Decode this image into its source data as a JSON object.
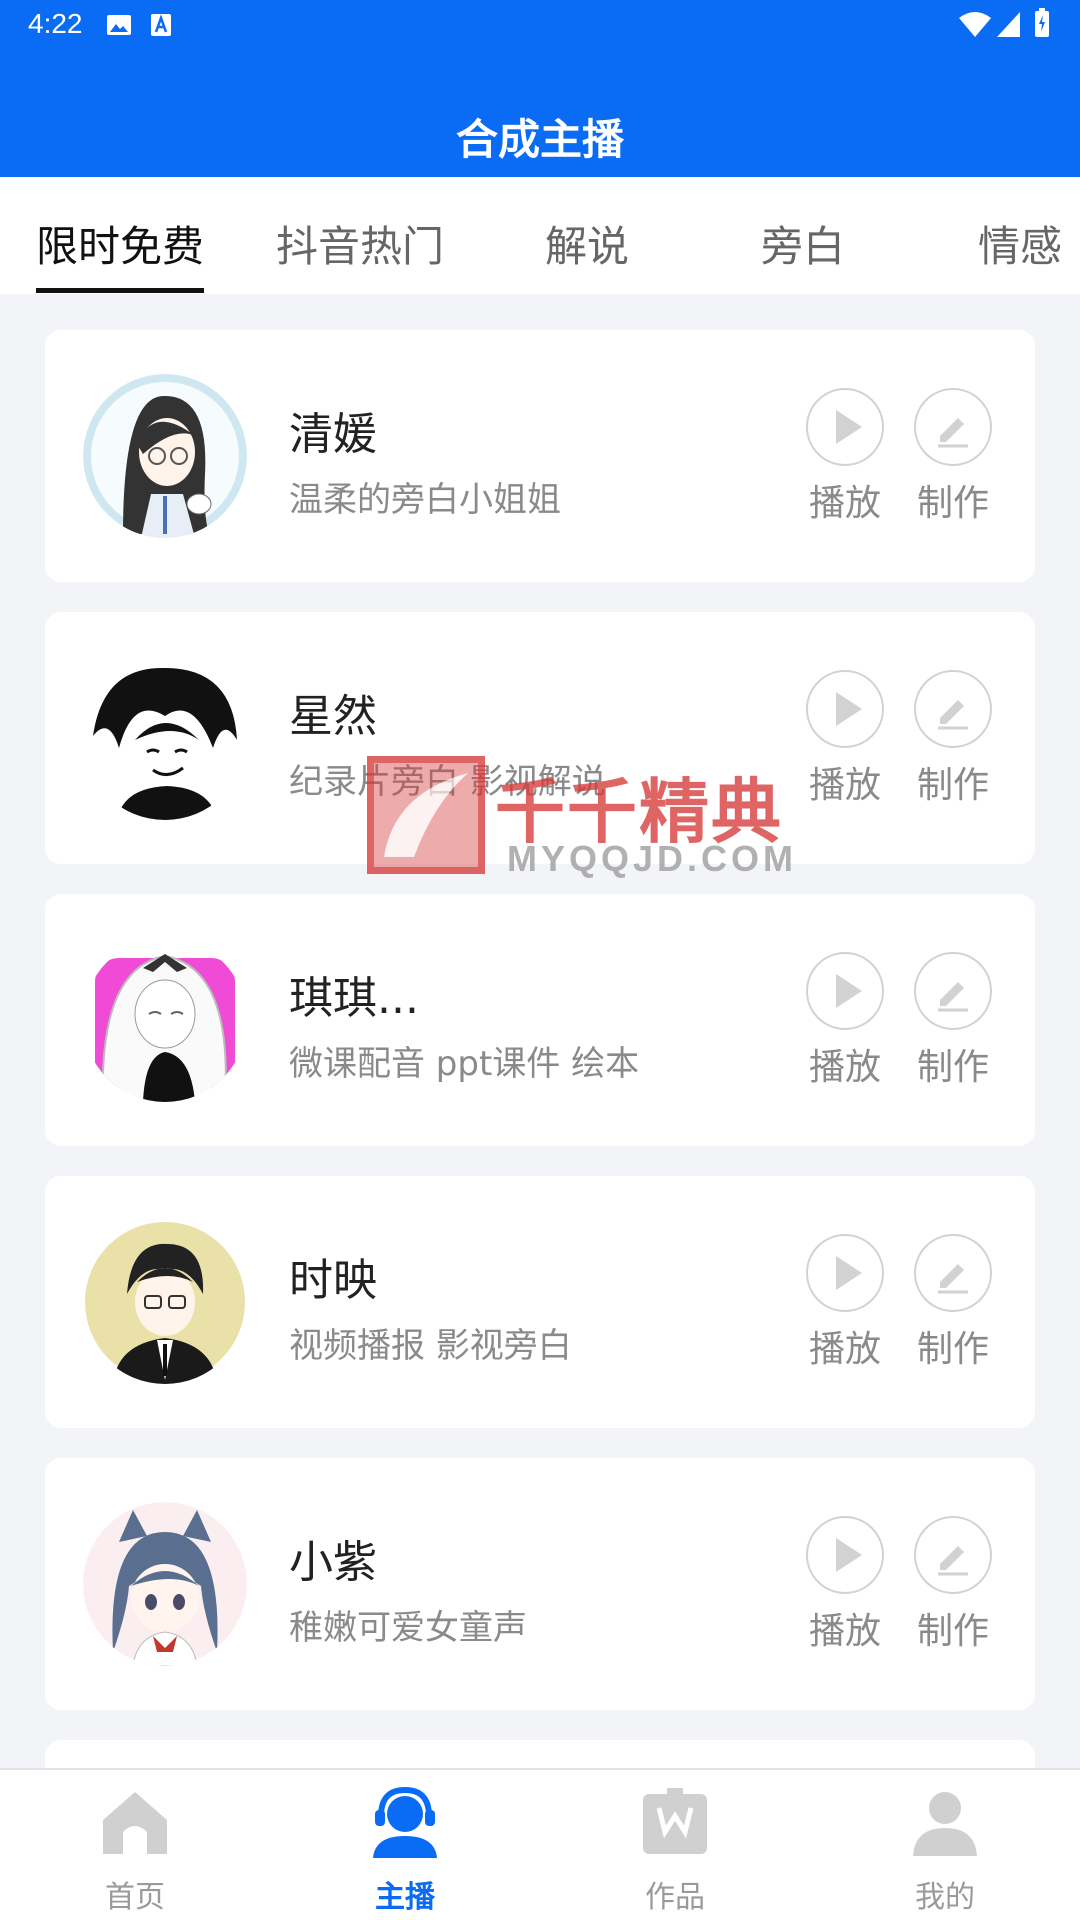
{
  "status_bar": {
    "time": "4:22"
  },
  "header": {
    "title": "合成主播"
  },
  "tabs": [
    {
      "label": "限时免费",
      "active": true
    },
    {
      "label": "抖音热门",
      "active": false
    },
    {
      "label": "解说",
      "active": false
    },
    {
      "label": "旁白",
      "active": false
    },
    {
      "label": "情感",
      "active": false
    }
  ],
  "anchors": [
    {
      "name": "清媛",
      "desc": "温柔的旁白小姐姐",
      "play_label": "播放",
      "make_label": "制作"
    },
    {
      "name": "星然",
      "desc": "纪录片旁白 影视解说",
      "play_label": "播放",
      "make_label": "制作"
    },
    {
      "name": "琪琪...",
      "desc": "微课配音 ppt课件 绘本",
      "play_label": "播放",
      "make_label": "制作"
    },
    {
      "name": "时映",
      "desc": "视频播报  影视旁白",
      "play_label": "播放",
      "make_label": "制作"
    },
    {
      "name": "小紫",
      "desc": "稚嫩可爱女童声",
      "play_label": "播放",
      "make_label": "制作"
    }
  ],
  "watermark": {
    "text_cn": "千千精典",
    "text_en": "MYQQJD.COM"
  },
  "bottom_nav": [
    {
      "label": "首页",
      "icon": "home-icon",
      "active": false
    },
    {
      "label": "主播",
      "icon": "headset-user-icon",
      "active": true
    },
    {
      "label": "作品",
      "icon": "works-icon",
      "active": false
    },
    {
      "label": "我的",
      "icon": "profile-icon",
      "active": false
    }
  ],
  "colors": {
    "accent": "#0a6cf5",
    "background": "#f3f4f8",
    "watermark_red": "#d73a3a"
  }
}
